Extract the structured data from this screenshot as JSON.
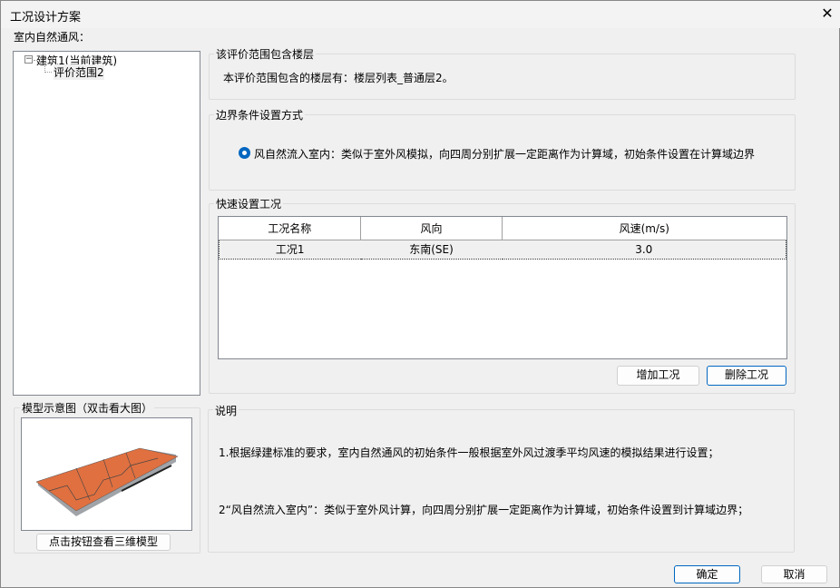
{
  "window": {
    "title": "工况设计方案",
    "close_icon": "close-icon"
  },
  "section_label": "室内自然通风：",
  "tree": {
    "root": "建筑1(当前建筑)",
    "child": "评价范围2"
  },
  "floors": {
    "title": "该评价范围包含楼层",
    "text": "本评价范围包含的楼层有：楼层列表_普通层2。"
  },
  "boundary": {
    "title": "边界条件设置方式",
    "option": "风自然流入室内：类似于室外风模拟，向四周分别扩展一定距离作为计算域，初始条件设置在计算域边界",
    "selected": true
  },
  "quick": {
    "title": "快速设置工况",
    "columns": [
      "工况名称",
      "风向",
      "风速(m/s)"
    ],
    "rows": [
      [
        "工况1",
        "东南(SE)",
        "3.0"
      ]
    ],
    "add_label": "增加工况",
    "delete_label": "删除工况"
  },
  "model": {
    "title": "模型示意图（双击看大图）",
    "view3d_label": "点击按钮查看三维模型"
  },
  "notes": {
    "title": "说明",
    "lines": [
      "1.根据绿建标准的要求，室内自然通风的初始条件一般根据室外风过渡季平均风速的模拟结果进行设置；",
      "2“风自然流入室内”：类似于室外风计算，向四周分别扩展一定距离作为计算域，初始条件设置到计算域边界；"
    ]
  },
  "footer": {
    "ok_label": "确定",
    "cancel_label": "取消"
  },
  "colors": {
    "accent": "#0067c0",
    "roof": "#e07040"
  }
}
